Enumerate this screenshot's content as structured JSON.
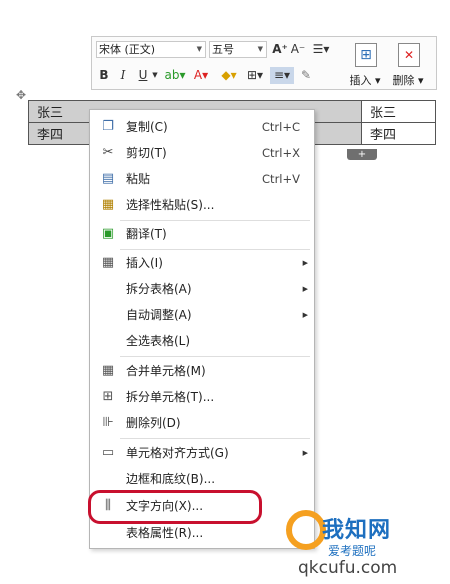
{
  "toolbar": {
    "font_name": "宋体 (正文)",
    "font_size": "五号",
    "grow_font": "A⁺",
    "shrink_font": "A⁻",
    "bold": "B",
    "italic": "I",
    "underline": "U",
    "insert_label": "插入",
    "delete_label": "删除"
  },
  "table": {
    "rows": [
      [
        "张三",
        "张三"
      ],
      [
        "李四",
        "李四"
      ]
    ]
  },
  "menu": {
    "copy": {
      "label": "复制(C)",
      "shortcut": "Ctrl+C"
    },
    "cut": {
      "label": "剪切(T)",
      "shortcut": "Ctrl+X"
    },
    "paste": {
      "label": "粘贴",
      "shortcut": "Ctrl+V"
    },
    "paste_special": {
      "label": "选择性粘贴(S)..."
    },
    "translate": {
      "label": "翻译(T)"
    },
    "insert": {
      "label": "插入(I)"
    },
    "split_table": {
      "label": "拆分表格(A)"
    },
    "autofit": {
      "label": "自动调整(A)"
    },
    "select_table": {
      "label": "全选表格(L)"
    },
    "merge_cells": {
      "label": "合并单元格(M)"
    },
    "split_cells": {
      "label": "拆分单元格(T)..."
    },
    "delete_column": {
      "label": "删除列(D)"
    },
    "cell_align": {
      "label": "单元格对齐方式(G)"
    },
    "borders": {
      "label": "边框和底纹(B)..."
    },
    "text_direction": {
      "label": "文字方向(X)..."
    },
    "table_props": {
      "label": "表格属性(R)..."
    }
  },
  "watermark": {
    "line1": "我知网",
    "line2": "爱考题呢",
    "line3": "qkcufu.com"
  },
  "colors": {
    "highlight_border": "#c8102e",
    "icon_blue": "#3f6ea8",
    "selection_gray": "#cfcfcf"
  }
}
